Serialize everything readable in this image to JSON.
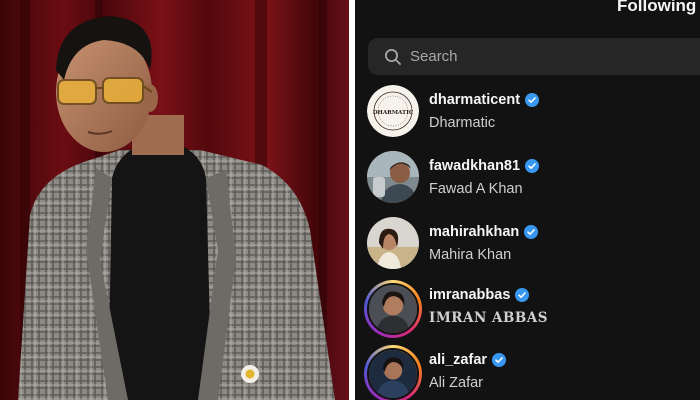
{
  "header": {
    "title": "Following"
  },
  "search": {
    "placeholder": "Search",
    "icon": "search-icon"
  },
  "following": [
    {
      "username": "dharmaticent",
      "full_name": "Dharmatic",
      "verified": true,
      "story_ring": false,
      "avatar": "dharmatic-logo"
    },
    {
      "username": "fawadkhan81",
      "full_name": "Fawad A Khan",
      "verified": true,
      "story_ring": false,
      "avatar": "profile-photo"
    },
    {
      "username": "mahirahkhan",
      "full_name": "Mahira Khan",
      "verified": true,
      "story_ring": false,
      "avatar": "profile-photo"
    },
    {
      "username": "imranabbas",
      "full_name": "IMRAN ABBAS",
      "verified": true,
      "story_ring": true,
      "avatar": "profile-photo"
    },
    {
      "username": "ali_zafar",
      "full_name": "Ali Zafar",
      "verified": true,
      "story_ring": true,
      "avatar": "profile-photo"
    }
  ],
  "avatar_logo_text": "DHARMATIC",
  "colors": {
    "background": "#121212",
    "search_field": "#262626",
    "verified_badge": "#3897f0",
    "story_ring": [
      "#feda75",
      "#fa7e1e",
      "#d62976",
      "#962fbf",
      "#4f5bd5"
    ],
    "curtain": "#6b0d12"
  }
}
